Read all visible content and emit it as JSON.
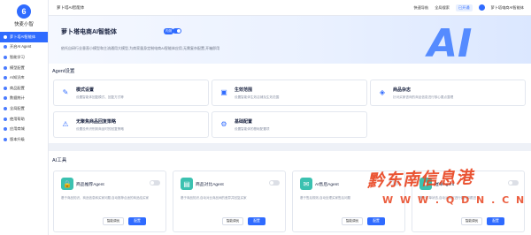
{
  "app": {
    "logo_glyph": "6",
    "name": "快麦小智"
  },
  "sidebar": {
    "items": [
      {
        "label": "萝卜塔AI智能体",
        "active": true
      },
      {
        "label": "开启AI Agent"
      },
      {
        "label": "智能学习"
      },
      {
        "label": "模型配置"
      },
      {
        "label": "AI知识库"
      },
      {
        "label": "商品配置"
      },
      {
        "label": "数据统计"
      },
      {
        "label": "全局配置"
      },
      {
        "label": "使用帮助"
      },
      {
        "label": "应用商城"
      },
      {
        "label": "版本升级"
      }
    ]
  },
  "topbar": {
    "breadcrumb": "萝卜塔AI智能体",
    "items": [
      "快速导航",
      "全局搜索",
      "已开通",
      "萝卜塔电商AI智能体"
    ]
  },
  "hero": {
    "title": "萝卜塔电商AI智能体",
    "tag": "内测",
    "desc": "依托自研行业垂直小模型和主流通用大模型,为商家量身定制电商AI智能体应用,无需复杂配置,开箱即用",
    "art_text": "AI"
  },
  "agent_settings": {
    "title": "Agent设置",
    "cards": [
      {
        "icon": "✎",
        "title": "模式设置",
        "desc": "设置智能体回复模式、回复方式等"
      },
      {
        "icon": "▣",
        "title": "生效范围",
        "desc": "设置智能体生效店铺及生效范围"
      },
      {
        "icon": "◈",
        "title": "商品杂志",
        "desc": "针对买家咨询的商品信息进行核心要点整理"
      },
      {
        "icon": "⚠",
        "title": "无聚焦商品回复策略",
        "desc": "设置没有识别到商品时的回复策略"
      },
      {
        "icon": "⚙",
        "title": "基础配置",
        "desc": "设置智能体的基础配置项"
      }
    ]
  },
  "ai_tools": {
    "title": "AI工具",
    "cards": [
      {
        "icon": "🔒",
        "name": "商品推荐Agent",
        "desc": "基于商品知识、商品信息和买家问题,自动推荐合适的商品给买家",
        "btn_secondary": "智能调优",
        "btn_primary": "配置"
      },
      {
        "icon": "▤",
        "name": "商品对比Agent",
        "desc": "基于商品知识,自动对比商品间的差异并回复买家",
        "btn_secondary": "智能调优",
        "btn_primary": "配置"
      },
      {
        "icon": "✉",
        "name": "AI售后Agent",
        "desc": "基于售后规则,自动处理买家售后问题",
        "btn_secondary": "智能调优",
        "btn_primary": "配置"
      },
      {
        "icon": "✦",
        "name": "催单Agent",
        "desc": "基于订单状态,自动对买家进行催付和跟进",
        "btn_secondary": "智能调优",
        "btn_primary": "配置"
      }
    ]
  },
  "watermark": {
    "text": "黔东南信息港",
    "url": "W W W . Q D N . C N"
  },
  "colors": {
    "accent": "#2f6bff",
    "tool_icon": "#3bc1b0",
    "watermark": "#e8421e"
  }
}
